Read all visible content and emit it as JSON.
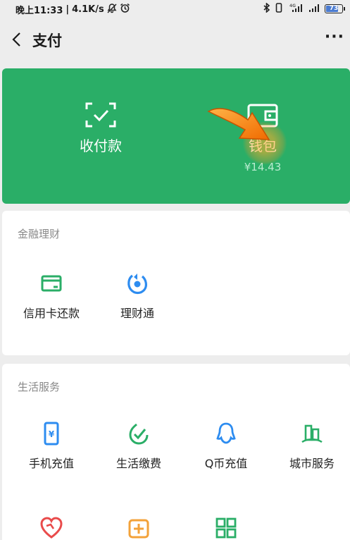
{
  "status_bar": {
    "time": "晚上11:33",
    "speed": "4.1K/s",
    "network": "4G",
    "battery": "73"
  },
  "nav": {
    "title": "支付",
    "more": "···"
  },
  "pay_card": {
    "collect_label": "收付款",
    "wallet_label": "钱包",
    "wallet_balance": "¥14.43"
  },
  "finance": {
    "title": "金融理财",
    "items": [
      {
        "label": "信用卡还款",
        "icon": "credit-card-icon"
      },
      {
        "label": "理财通",
        "icon": "licaitong-icon"
      }
    ]
  },
  "life": {
    "title": "生活服务",
    "items": [
      {
        "label": "手机充值",
        "icon": "phone-recharge-icon"
      },
      {
        "label": "生活缴费",
        "icon": "utility-payment-icon"
      },
      {
        "label": "Q币充值",
        "icon": "qq-coin-icon"
      },
      {
        "label": "城市服务",
        "icon": "city-service-icon"
      }
    ]
  },
  "colors": {
    "brand_green": "#2aae67",
    "service_blue": "#2d8cf0",
    "service_green": "#2aae67",
    "service_red": "#e94b4b",
    "service_orange": "#f3a23a"
  }
}
